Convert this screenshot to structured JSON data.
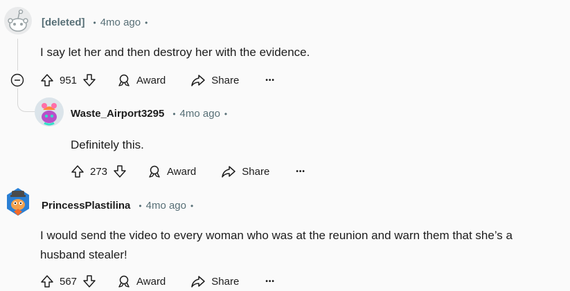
{
  "comments": [
    {
      "username": "[deleted]",
      "time": "4mo ago",
      "body": "I say let her and then destroy her with the evidence.",
      "votes": "951",
      "award_label": "Award",
      "share_label": "Share",
      "more_label": "•••"
    },
    {
      "username": "Waste_Airport3295",
      "time": "4mo ago",
      "body": "Definitely this.",
      "votes": "273",
      "award_label": "Award",
      "share_label": "Share",
      "more_label": "•••"
    },
    {
      "username": "PrincessPlastilina",
      "time": "4mo ago",
      "body_line1": "I would send the video to every woman who was at the reunion and warn them that she’s a",
      "body_line2": "husband stealer!",
      "votes": "567",
      "award_label": "Award",
      "share_label": "Share",
      "more_label": "•••"
    }
  ],
  "colors": {
    "meta": "#576f76",
    "text": "#1c1c1c",
    "thread": "#d6d6d6",
    "bg": "#fafafa"
  },
  "icons": [
    "snoo-avatar-icon",
    "upvote-icon",
    "downvote-icon",
    "award-icon",
    "share-icon",
    "collapse-icon"
  ]
}
